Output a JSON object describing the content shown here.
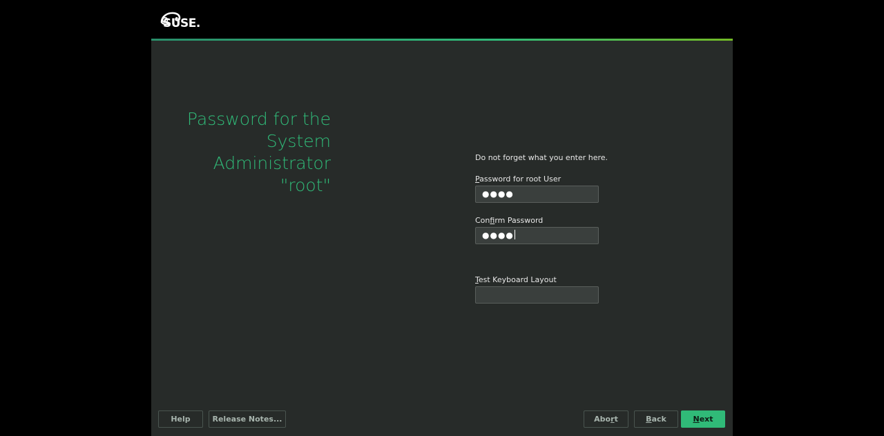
{
  "branding": {
    "logo_text": "SUSE."
  },
  "page": {
    "title": "Password for the System Administrator \"root\""
  },
  "form": {
    "hint": "Do not forget what you enter here.",
    "password_label_mnemonic": "P",
    "password_label_rest": "assword for root User",
    "password_value": "●●●●",
    "confirm_label_pre": "Con",
    "confirm_label_mnemonic": "f",
    "confirm_label_rest": "irm Password",
    "confirm_value": "●●●●",
    "keyboard_label_mnemonic": "T",
    "keyboard_label_rest": "est Keyboard Layout",
    "keyboard_value": ""
  },
  "footer": {
    "help_label": "Help",
    "release_notes_label": "Release Notes...",
    "abort_pre": "Abo",
    "abort_mnemonic": "r",
    "abort_post": "t",
    "back_mnemonic": "B",
    "back_rest": "ack",
    "next_mnemonic": "N",
    "next_rest": "ext"
  },
  "colors": {
    "accent": "#30ba78",
    "panel": "#272b29",
    "background": "#000000"
  }
}
